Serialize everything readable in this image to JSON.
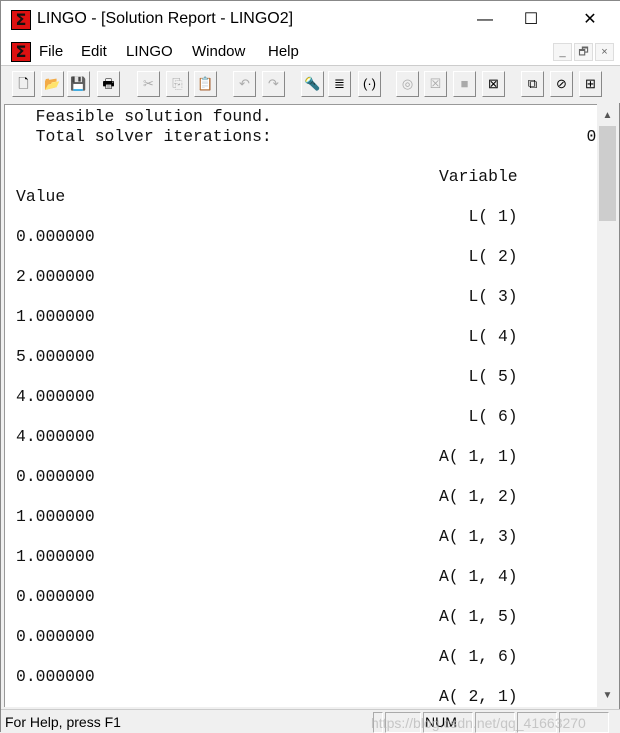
{
  "window": {
    "title": "LINGO - [Solution Report - LINGO2]",
    "minimize": "—",
    "maximize": "☐",
    "close": "✕"
  },
  "menu": {
    "items": [
      "File",
      "Edit",
      "LINGO",
      "Window",
      "Help"
    ],
    "mdi": [
      "_",
      "🗗",
      "×"
    ]
  },
  "toolbar": {
    "buttons": [
      {
        "icon": "new-file-icon",
        "glyph": "🗋",
        "disabled": false
      },
      {
        "icon": "open-folder-icon",
        "glyph": "📂",
        "disabled": false
      },
      {
        "icon": "save-icon",
        "glyph": "💾",
        "disabled": false
      },
      {
        "icon": "print-icon",
        "glyph": "🖶",
        "disabled": false
      },
      {
        "icon": "cut-icon",
        "glyph": "✂",
        "disabled": true
      },
      {
        "icon": "copy-icon",
        "glyph": "⎘",
        "disabled": true
      },
      {
        "icon": "paste-icon",
        "glyph": "📋",
        "disabled": false
      },
      {
        "icon": "undo-icon",
        "glyph": "↶",
        "disabled": true
      },
      {
        "icon": "redo-icon",
        "glyph": "↷",
        "disabled": true
      },
      {
        "icon": "find-icon",
        "glyph": "🔦",
        "disabled": false
      },
      {
        "icon": "goto-line-icon",
        "glyph": "≣",
        "disabled": false
      },
      {
        "icon": "match-parenthesis-icon",
        "glyph": "(·)",
        "disabled": false
      },
      {
        "icon": "solve-icon",
        "glyph": "◎",
        "disabled": true
      },
      {
        "icon": "solution-icon",
        "glyph": "☒",
        "disabled": true
      },
      {
        "icon": "stop-icon",
        "glyph": "■",
        "disabled": true
      },
      {
        "icon": "close-all-icon",
        "glyph": "⊠",
        "disabled": false
      },
      {
        "icon": "send-to-back-icon",
        "glyph": "⧉",
        "disabled": false
      },
      {
        "icon": "close-window-icon",
        "glyph": "⊘",
        "disabled": false
      },
      {
        "icon": "tile-icon",
        "glyph": "⊞",
        "disabled": false
      }
    ]
  },
  "report": {
    "lines": [
      "  Feasible solution found.",
      "  Total solver iterations:                                0",
      "",
      "                                           Variable",
      "Value",
      "                                              L( 1)",
      "0.000000",
      "                                              L( 2)",
      "2.000000",
      "                                              L( 3)",
      "1.000000",
      "                                              L( 4)",
      "5.000000",
      "                                              L( 5)",
      "4.000000",
      "                                              L( 6)",
      "4.000000",
      "                                           A( 1, 1)",
      "0.000000",
      "                                           A( 1, 2)",
      "1.000000",
      "                                           A( 1, 3)",
      "1.000000",
      "                                           A( 1, 4)",
      "0.000000",
      "                                           A( 1, 5)",
      "0.000000",
      "                                           A( 1, 6)",
      "0.000000",
      "                                           A( 2, 1)"
    ]
  },
  "status": {
    "help": "For Help, press F1",
    "num": "NUM",
    "watermark": "https://blog.csdn.net/qq_41663270"
  }
}
